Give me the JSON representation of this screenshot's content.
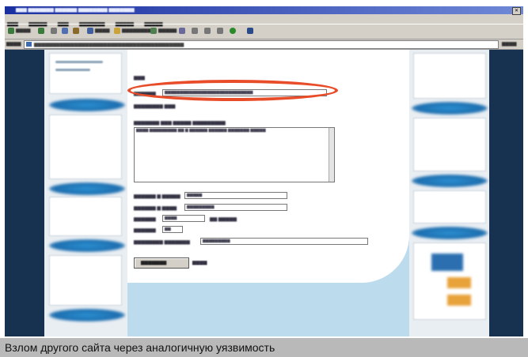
{
  "caption": "Взлом другого сайта через аналогичную уязвимость"
}
